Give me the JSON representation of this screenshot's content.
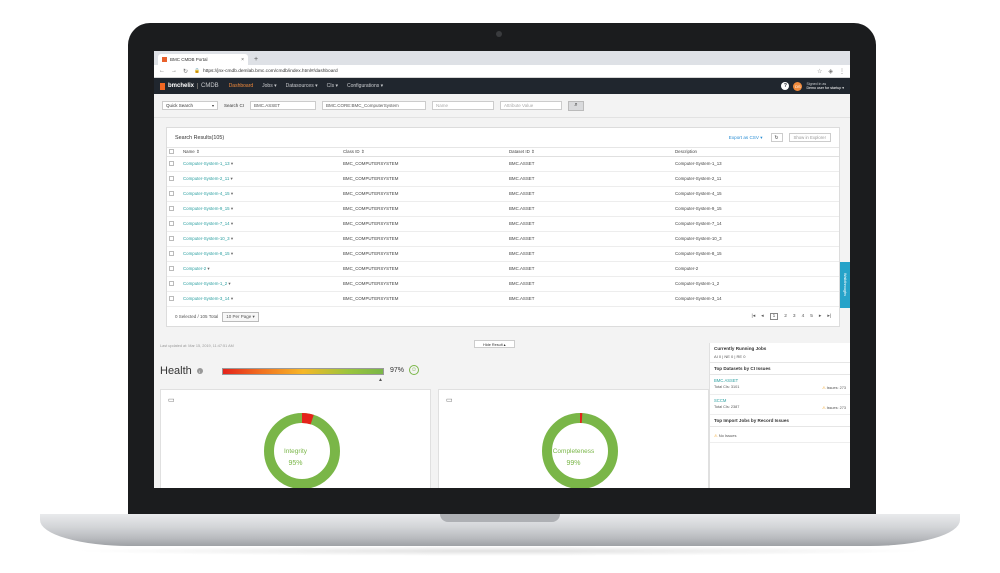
{
  "browser": {
    "tab_title": "BMC CMDB Portal",
    "url": "https://jnx-cmdb.demlab.bmc.com/cmdb/index.html#/dashboard"
  },
  "appnav": {
    "brand": "bmchelix",
    "product": "CMDB",
    "items": [
      "Dashboard",
      "Jobs ▾",
      "Datasources ▾",
      "CIs ▾",
      "Configurations ▾"
    ],
    "avatar_initials": "DS",
    "signed_in_label": "Signed in as",
    "user": "Demo user for startup ▾"
  },
  "search": {
    "mode": "Quick Search",
    "label": "Search CI",
    "dataset": "BMC.ASSET",
    "class": "BMC.CORE:BMC_ComputerSystem",
    "name_placeholder": "Name",
    "attr_placeholder": "Attribute Value"
  },
  "results": {
    "title": "Search Results(105)",
    "export": "Export as CSV ▾",
    "explorer": "Show in Explorer",
    "columns": [
      "Name",
      "Class ID",
      "Dataset ID",
      "Description"
    ],
    "rows": [
      [
        "Computer-System-1_13",
        "BMC_COMPUTERSYSTEM",
        "BMC.ASSET",
        "Computer-System-1_13"
      ],
      [
        "Computer-System-2_11",
        "BMC_COMPUTERSYSTEM",
        "BMC.ASSET",
        "Computer-System-2_11"
      ],
      [
        "Computer-System-4_15",
        "BMC_COMPUTERSYSTEM",
        "BMC.ASSET",
        "Computer-System-4_15"
      ],
      [
        "Computer-System-9_15",
        "BMC_COMPUTERSYSTEM",
        "BMC.ASSET",
        "Computer-System-9_15"
      ],
      [
        "Computer-System-7_14",
        "BMC_COMPUTERSYSTEM",
        "BMC.ASSET",
        "Computer-System-7_14"
      ],
      [
        "Computer-System-10_3",
        "BMC_COMPUTERSYSTEM",
        "BMC.ASSET",
        "Computer-System-10_3"
      ],
      [
        "Computer-System-8_15",
        "BMC_COMPUTERSYSTEM",
        "BMC.ASSET",
        "Computer-System-8_15"
      ],
      [
        "Computer-2",
        "BMC_COMPUTERSYSTEM",
        "BMC.ASSET",
        "Computer-2"
      ],
      [
        "Computer-System-1_2",
        "BMC_COMPUTERSYSTEM",
        "BMC.ASSET",
        "Computer-System-1_2"
      ],
      [
        "Computer-System-3_14",
        "BMC_COMPUTERSYSTEM",
        "BMC.ASSET",
        "Computer-System-3_14"
      ]
    ],
    "footer_count": "0 Selected / 105 Total",
    "per_page": "10 Per Page ▾",
    "pages": [
      "1",
      "2",
      "3",
      "4",
      "5"
    ],
    "walkthrough": "Walkthroughs"
  },
  "dashboard": {
    "last_updated": "Last updated at: Mar 15, 2019, 11:47:51 AM",
    "hide_result": "Hide Result ▴",
    "health_title": "Health",
    "health_value": 97,
    "health_pct": "97%",
    "integrity": {
      "label": "Integrity",
      "value": "95%",
      "fraction": 0.95
    },
    "completeness": {
      "label": "Completeness",
      "value": "99%",
      "fraction": 0.99
    },
    "colors": {
      "good": "#7ab648",
      "bad": "#e4231b"
    }
  },
  "side": {
    "running_title": "Currently Running Jobs",
    "running_sub": "AI 0 | NE 0 | RE 0",
    "datasets_title": "Top Datasets by CI Issues",
    "datasets": [
      {
        "name": "BMC.ASSET",
        "total": "Total CIs: 3101",
        "issues": "Issues: 273"
      },
      {
        "name": "SCCM",
        "total": "Total CIs: 2387",
        "issues": "Issues: 273"
      }
    ],
    "import_title": "Top Import Jobs by Record Issues",
    "no_issues": "No Issues"
  }
}
